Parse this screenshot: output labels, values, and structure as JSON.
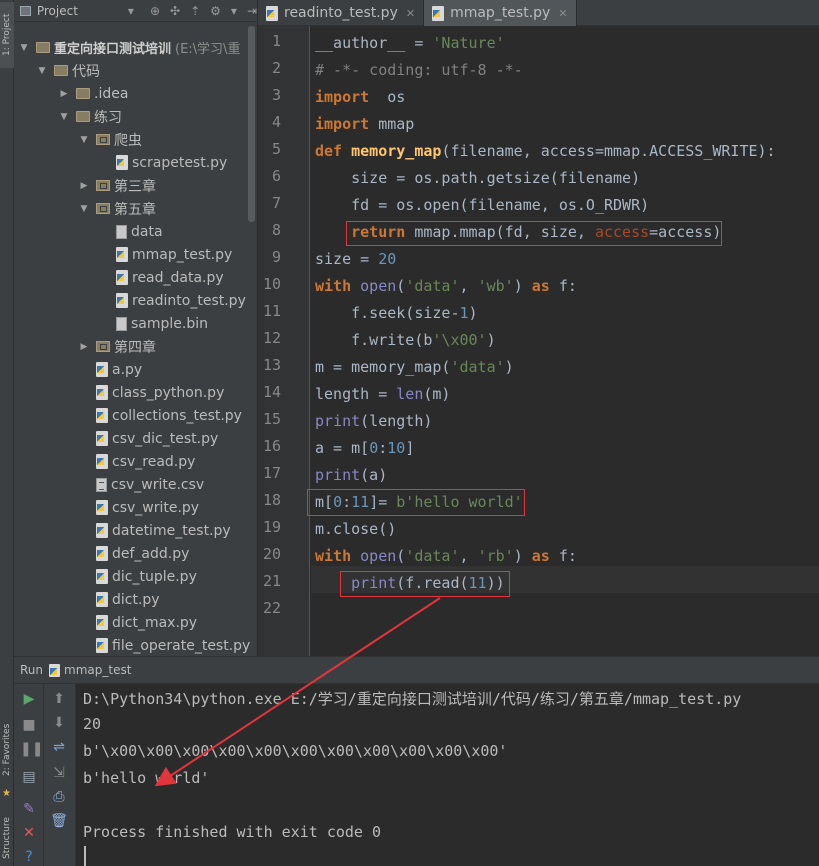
{
  "sidebar_tabs": {
    "project": "1: Project",
    "favorites": "2: Favorites",
    "structure": "Structure"
  },
  "project_panel": {
    "title": "Project",
    "tree": [
      {
        "label": "重定向接口测试培训",
        "path": "(E:\\学习\\重",
        "type": "root",
        "level": 0,
        "expanded": true
      },
      {
        "label": "代码",
        "type": "folder",
        "level": 1,
        "expanded": true
      },
      {
        "label": ".idea",
        "type": "folder",
        "level": 2,
        "expanded": false
      },
      {
        "label": "练习",
        "type": "folder",
        "level": 2,
        "expanded": true
      },
      {
        "label": "爬虫",
        "type": "package",
        "level": 3,
        "expanded": true
      },
      {
        "label": "scrapetest.py",
        "type": "py",
        "level": 4
      },
      {
        "label": "第三章",
        "type": "package",
        "level": 3,
        "expanded": false
      },
      {
        "label": "第五章",
        "type": "package",
        "level": 3,
        "expanded": true
      },
      {
        "label": "data",
        "type": "file",
        "level": 4
      },
      {
        "label": "mmap_test.py",
        "type": "py",
        "level": 4
      },
      {
        "label": "read_data.py",
        "type": "py",
        "level": 4
      },
      {
        "label": "readinto_test.py",
        "type": "py",
        "level": 4
      },
      {
        "label": "sample.bin",
        "type": "file",
        "level": 4
      },
      {
        "label": "第四章",
        "type": "package",
        "level": 3,
        "expanded": false
      },
      {
        "label": "a.py",
        "type": "py",
        "level": 3
      },
      {
        "label": "class_python.py",
        "type": "py",
        "level": 3
      },
      {
        "label": "collections_test.py",
        "type": "py",
        "level": 3
      },
      {
        "label": "csv_dic_test.py",
        "type": "py",
        "level": 3
      },
      {
        "label": "csv_read.py",
        "type": "py",
        "level": 3
      },
      {
        "label": "csv_write.csv",
        "type": "csv",
        "level": 3
      },
      {
        "label": "csv_write.py",
        "type": "py",
        "level": 3
      },
      {
        "label": "datetime_test.py",
        "type": "py",
        "level": 3
      },
      {
        "label": "def_add.py",
        "type": "py",
        "level": 3
      },
      {
        "label": "dic_tuple.py",
        "type": "py",
        "level": 3
      },
      {
        "label": "dict.py",
        "type": "py",
        "level": 3
      },
      {
        "label": "dict_max.py",
        "type": "py",
        "level": 3
      },
      {
        "label": "file_operate_test.py",
        "type": "py",
        "level": 3
      }
    ]
  },
  "editor_tabs": [
    {
      "label": "readinto_test.py",
      "active": false
    },
    {
      "label": "mmap_test.py",
      "active": true
    }
  ],
  "code_lines": [
    [
      [
        "",
        "__author__"
      ],
      [
        "",
        " = "
      ],
      [
        "str",
        "'Nature'"
      ]
    ],
    [
      [
        "cmt",
        "# -*- coding: utf-8 -*-"
      ]
    ],
    [
      [
        "kw",
        "import"
      ],
      [
        "",
        "  os"
      ]
    ],
    [
      [
        "kw",
        "import"
      ],
      [
        "",
        " mmap"
      ]
    ],
    [
      [
        "kw",
        "def "
      ],
      [
        "fn",
        "memory_map"
      ],
      [
        "",
        "(filename, access=mmap.ACCESS_WRITE):"
      ]
    ],
    [
      [
        "",
        "    size = os.path.getsize(filename)"
      ]
    ],
    [
      [
        "",
        "    fd = os.open(filename, os.O_RDWR)"
      ]
    ],
    [
      [
        "",
        "    "
      ],
      [
        "kw",
        "return"
      ],
      [
        "",
        " mmap.mmap(fd, size, "
      ],
      [
        "par",
        "access"
      ],
      [
        "",
        "=access)"
      ]
    ],
    [
      [
        "",
        "size = "
      ],
      [
        "num",
        "20"
      ]
    ],
    [
      [
        "kw",
        "with "
      ],
      [
        "bi",
        "open"
      ],
      [
        "",
        "("
      ],
      [
        "str",
        "'data'"
      ],
      [
        "",
        ", "
      ],
      [
        "str",
        "'wb'"
      ],
      [
        "",
        ") "
      ],
      [
        "kw",
        "as"
      ],
      [
        "",
        " f:"
      ]
    ],
    [
      [
        "",
        "    f.seek(size-"
      ],
      [
        "num",
        "1"
      ],
      [
        "",
        ")"
      ]
    ],
    [
      [
        "",
        "    f.write(b"
      ],
      [
        "str",
        "'\\x00'"
      ],
      [
        "",
        ")"
      ]
    ],
    [
      [
        "",
        "m = memory_map("
      ],
      [
        "str",
        "'data'"
      ],
      [
        "",
        ")"
      ]
    ],
    [
      [
        "",
        "length = "
      ],
      [
        "bi",
        "len"
      ],
      [
        "",
        "(m)"
      ]
    ],
    [
      [
        "bi",
        "print"
      ],
      [
        "",
        "(length)"
      ]
    ],
    [
      [
        "",
        "a = m["
      ],
      [
        "num",
        "0"
      ],
      [
        "",
        ":"
      ],
      [
        "num",
        "10"
      ],
      [
        "",
        "]"
      ]
    ],
    [
      [
        "bi",
        "print"
      ],
      [
        "",
        "(a)"
      ]
    ],
    [
      [
        "",
        "m["
      ],
      [
        "num",
        "0"
      ],
      [
        "",
        ":"
      ],
      [
        "num",
        "11"
      ],
      [
        "",
        "]= "
      ],
      [
        "str",
        "b'hello world'"
      ]
    ],
    [
      [
        "",
        "m.close()"
      ]
    ],
    [
      [
        "kw",
        "with "
      ],
      [
        "bi",
        "open"
      ],
      [
        "",
        "("
      ],
      [
        "str",
        "'data'"
      ],
      [
        "",
        ", "
      ],
      [
        "str",
        "'rb'"
      ],
      [
        "",
        ") "
      ],
      [
        "kw",
        "as"
      ],
      [
        "",
        " f:"
      ]
    ],
    [
      [
        "",
        "    "
      ],
      [
        "bi",
        "print"
      ],
      [
        "",
        "(f.read("
      ],
      [
        "num",
        "11"
      ],
      [
        "",
        "))"
      ]
    ],
    []
  ],
  "run_panel": {
    "label": "Run",
    "config_name": "mmap_test",
    "console_lines": [
      "D:\\Python34\\python.exe E:/学习/重定向接口测试培训/代码/练习/第五章/mmap_test.py",
      "20",
      "b'\\x00\\x00\\x00\\x00\\x00\\x00\\x00\\x00\\x00\\x00\\x00'",
      "b'hello world'",
      "",
      "Process finished with exit code 0"
    ]
  },
  "colors": {
    "annotation": "#e2343b",
    "keyword": "#cc7832",
    "string": "#6a8759",
    "run_green": "#59a869"
  }
}
